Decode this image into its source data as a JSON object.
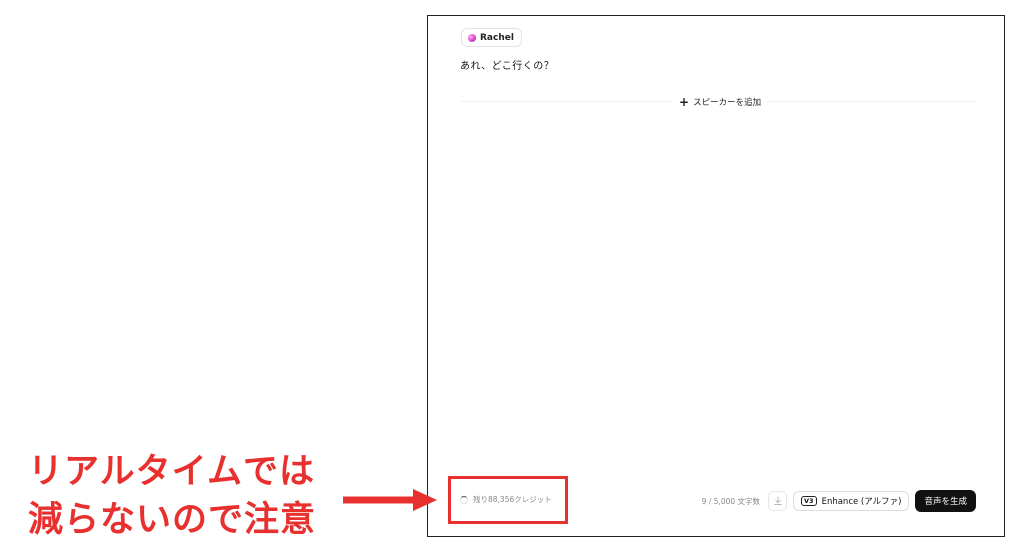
{
  "editor": {
    "speaker": {
      "name": "Rachel"
    },
    "dialog_text": "あれ、どこ行くの？",
    "add_speaker_label": "スピーカーを追加"
  },
  "footer": {
    "credits_label": "残り88,356クレジット",
    "char_count": "9 / 5,000 文字数",
    "enhance_badge": "V3",
    "enhance_label": "Enhance (アルファ)",
    "generate_label": "音声を生成"
  },
  "annotation": {
    "text_line1": "リアルタイムでは",
    "text_line2": "減らないので注意",
    "color": "#e8312f"
  }
}
